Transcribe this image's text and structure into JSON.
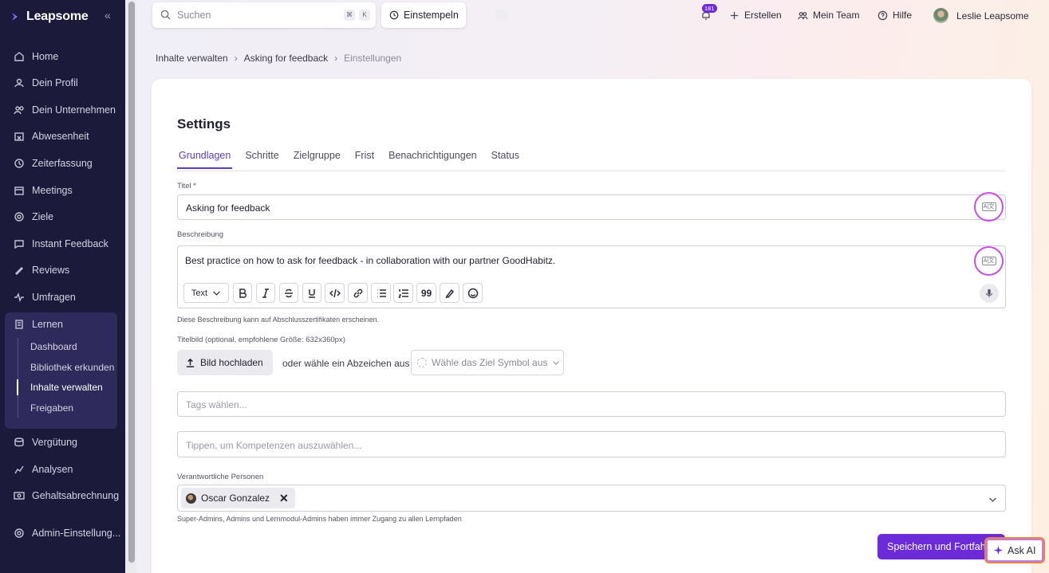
{
  "sidebar": {
    "logo": "Leapsome",
    "items": [
      {
        "label": "Home",
        "icon": "home-icon"
      },
      {
        "label": "Dein Profil",
        "icon": "user-icon"
      },
      {
        "label": "Dein Unternehmen",
        "icon": "people-icon"
      },
      {
        "label": "Abwesenheit",
        "icon": "calendar-x-icon"
      },
      {
        "label": "Zeiterfassung",
        "icon": "clock-icon"
      },
      {
        "label": "Meetings",
        "icon": "calendar-icon"
      },
      {
        "label": "Ziele",
        "icon": "target-icon"
      },
      {
        "label": "Instant Feedback",
        "icon": "chat-icon"
      },
      {
        "label": "Reviews",
        "icon": "pen-icon"
      },
      {
        "label": "Umfragen",
        "icon": "pulse-icon"
      },
      {
        "label": "Lernen",
        "icon": "book-icon"
      },
      {
        "label": "Vergütung",
        "icon": "coins-icon"
      },
      {
        "label": "Analysen",
        "icon": "chart-icon"
      },
      {
        "label": "Gehaltsabrechnung",
        "icon": "payroll-icon"
      },
      {
        "label": "Admin-Einstellung...",
        "icon": "gear-icon"
      }
    ],
    "lernen_sub": [
      "Dashboard",
      "Bibliothek erkunden",
      "Inhalte verwalten",
      "Freigaben"
    ]
  },
  "topbar": {
    "search_placeholder": "Suchen",
    "kbd1": "⌘",
    "kbd2": "K",
    "clock_in": "Einstempeln",
    "notif_count": "181",
    "create": "Erstellen",
    "my_team": "Mein Team",
    "help": "Hilfe",
    "user_name": "Leslie Leapsome"
  },
  "breadcrumb": [
    "Inhalte verwalten",
    "Asking for feedback",
    "Einstellungen"
  ],
  "page": {
    "title": "Settings",
    "tabs": [
      "Grundlagen",
      "Schritte",
      "Zielgruppe",
      "Frist",
      "Benachrichtigungen",
      "Status"
    ],
    "title_label": "Titel *",
    "title_value": "Asking for feedback",
    "desc_label": "Beschreibung",
    "desc_value": "Best practice on how to ask for feedback - in collaboration with our partner GoodHabitz.",
    "text_style": "Text",
    "desc_hint": "Diese Beschreibung kann auf Abschlusszertifikaten erscheinen.",
    "image_label": "Titelbild (optional, empfohlene Größe: 632x360px)",
    "upload_button": "Bild hochladen",
    "or_badge": "oder wähle ein Abzeichen aus",
    "badge_placeholder": "Wähle das Ziel Symbol aus",
    "tags_placeholder": "Tags wählen...",
    "skills_placeholder": "Tippen, um Kompetenzen auszuwählen...",
    "responsible_label": "Verantwortliche Personen",
    "responsible_person": "Oscar Gonzalez",
    "responsible_hint": "Super-Admins, Admins und Lernmodul-Admins haben immer Zugang zu allen Lernpfaden",
    "save_button": "Speichern und Fortfahren",
    "ask_ai": "Ask AI"
  },
  "colors": {
    "sidebar_bg": "#1b1a3a",
    "accent": "#6c2bd9",
    "highlight_ring": "#c94fe3"
  }
}
